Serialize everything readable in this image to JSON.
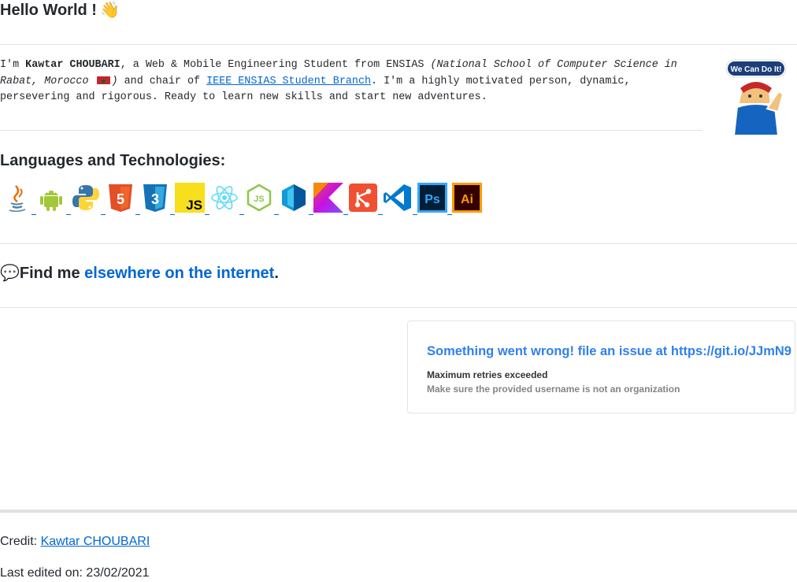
{
  "header": {
    "title": "Hello World !",
    "title_emoji": "👋"
  },
  "intro": {
    "part1": "I'm ",
    "name": "Kawtar CHOUBARI",
    "part2": ", a Web & Mobile Engineering Student from ENSIAS ",
    "school_italic": "(National School of Computer Science in Rabat, Morocco ",
    "school_close": ")",
    "part3": " and chair of ",
    "branch_link": "IEEE ENSIAS Student Branch",
    "part4": ". I'm a highly motivated person, dynamic, persevering and rigorous. Ready to learn new skills and start new adventures."
  },
  "sticker": {
    "text": "We Can Do It!"
  },
  "languages": {
    "heading": "Languages and Technologies:",
    "icons": [
      "java-icon",
      "android-icon",
      "python-icon",
      "html5-icon",
      "css3-icon",
      "javascript-icon",
      "react-icon",
      "nodejs-icon",
      "flutter-icon",
      "kotlin-icon",
      "git-icon",
      "vscode-icon",
      "photoshop-icon",
      "illustrator-icon"
    ]
  },
  "find": {
    "emoji": "💬",
    "prefix": "Find me ",
    "link": "elsewhere on the internet",
    "suffix": "."
  },
  "error_card": {
    "title": "Something went wrong! file an issue at https://git.io/JJmN9",
    "message": "Maximum retries exceeded",
    "hint": "Make sure the provided username is not an organization"
  },
  "footer": {
    "credit_label": "Credit: ",
    "credit_link": "Kawtar CHOUBARI",
    "last_edited": "Last edited on: 23/02/2021"
  },
  "colors": {
    "link": "#0366d6",
    "error_title": "#2f80ed",
    "divider": "#e1e4e8"
  }
}
